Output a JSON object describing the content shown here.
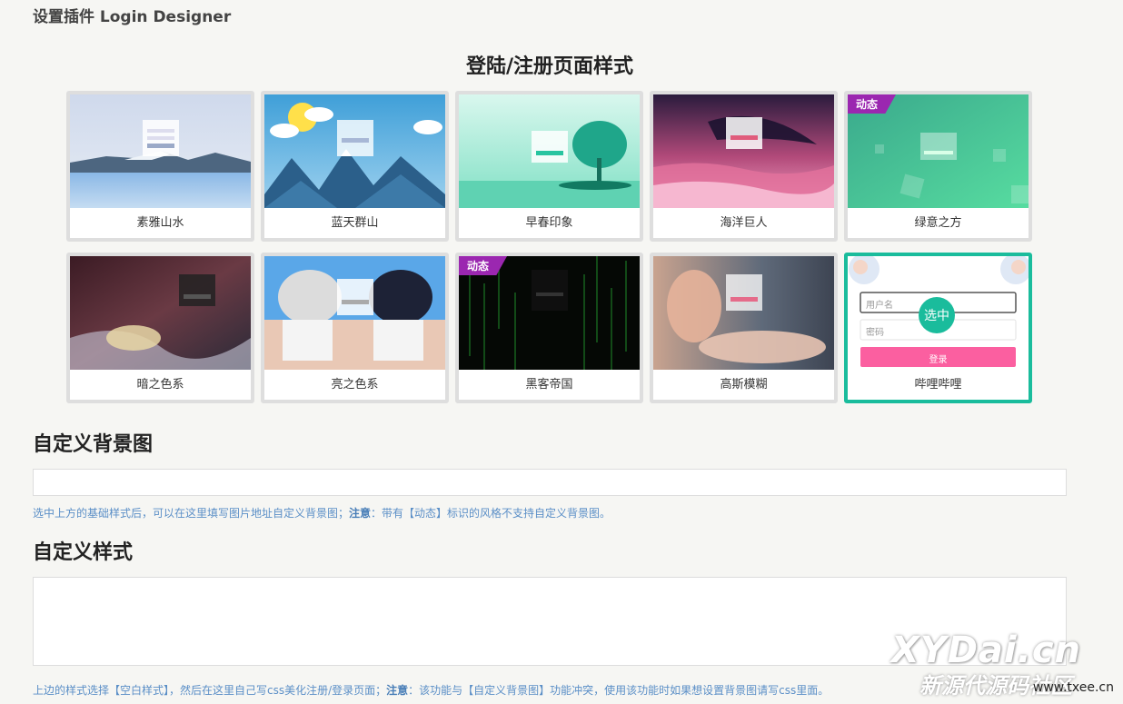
{
  "header": {
    "title": "设置插件 Login Designer"
  },
  "styles_section": {
    "title": "登陆/注册页面样式"
  },
  "dynamic_badge": "动态",
  "selected_badge": "选中",
  "cards": [
    {
      "label": "素雅山水",
      "dynamic": false,
      "selected": false
    },
    {
      "label": "蓝天群山",
      "dynamic": false,
      "selected": false
    },
    {
      "label": "早春印象",
      "dynamic": false,
      "selected": false
    },
    {
      "label": "海洋巨人",
      "dynamic": false,
      "selected": false
    },
    {
      "label": "绿意之方",
      "dynamic": true,
      "selected": false
    },
    {
      "label": "暗之色系",
      "dynamic": false,
      "selected": false
    },
    {
      "label": "亮之色系",
      "dynamic": false,
      "selected": false
    },
    {
      "label": "黑客帝国",
      "dynamic": true,
      "selected": false
    },
    {
      "label": "高斯模糊",
      "dynamic": false,
      "selected": false
    },
    {
      "label": "哔哩哔哩",
      "dynamic": false,
      "selected": true
    }
  ],
  "preview_bilibili": {
    "username_placeholder": "用户名",
    "password_placeholder": "密码",
    "login_label": "登录"
  },
  "custom_bg": {
    "title": "自定义背景图",
    "value": "",
    "hint_prefix": "选中上方的基础样式后，可以在这里填写图片地址自定义背景图；",
    "hint_note": "注意",
    "hint_suffix": "：带有【动态】标识的风格不支持自定义背景图。"
  },
  "custom_style": {
    "title": "自定义样式",
    "value": "",
    "hint_prefix": "上边的样式选择【空白样式】，然后在这里自己写css美化注册/登录页面；",
    "hint_note": "注意",
    "hint_suffix": "：该功能与【自定义背景图】功能冲突，使用该功能时如果想设置背景图请写css里面。"
  },
  "watermark": {
    "brand": "XYDai.cn",
    "cn": "新源代源码社区",
    "url": "www.txee.cn"
  },
  "colors": {
    "accent": "#1abc9c",
    "badge": "#9b27b0",
    "hint": "#5b8fc7",
    "bili_button": "#fb5fa0"
  }
}
